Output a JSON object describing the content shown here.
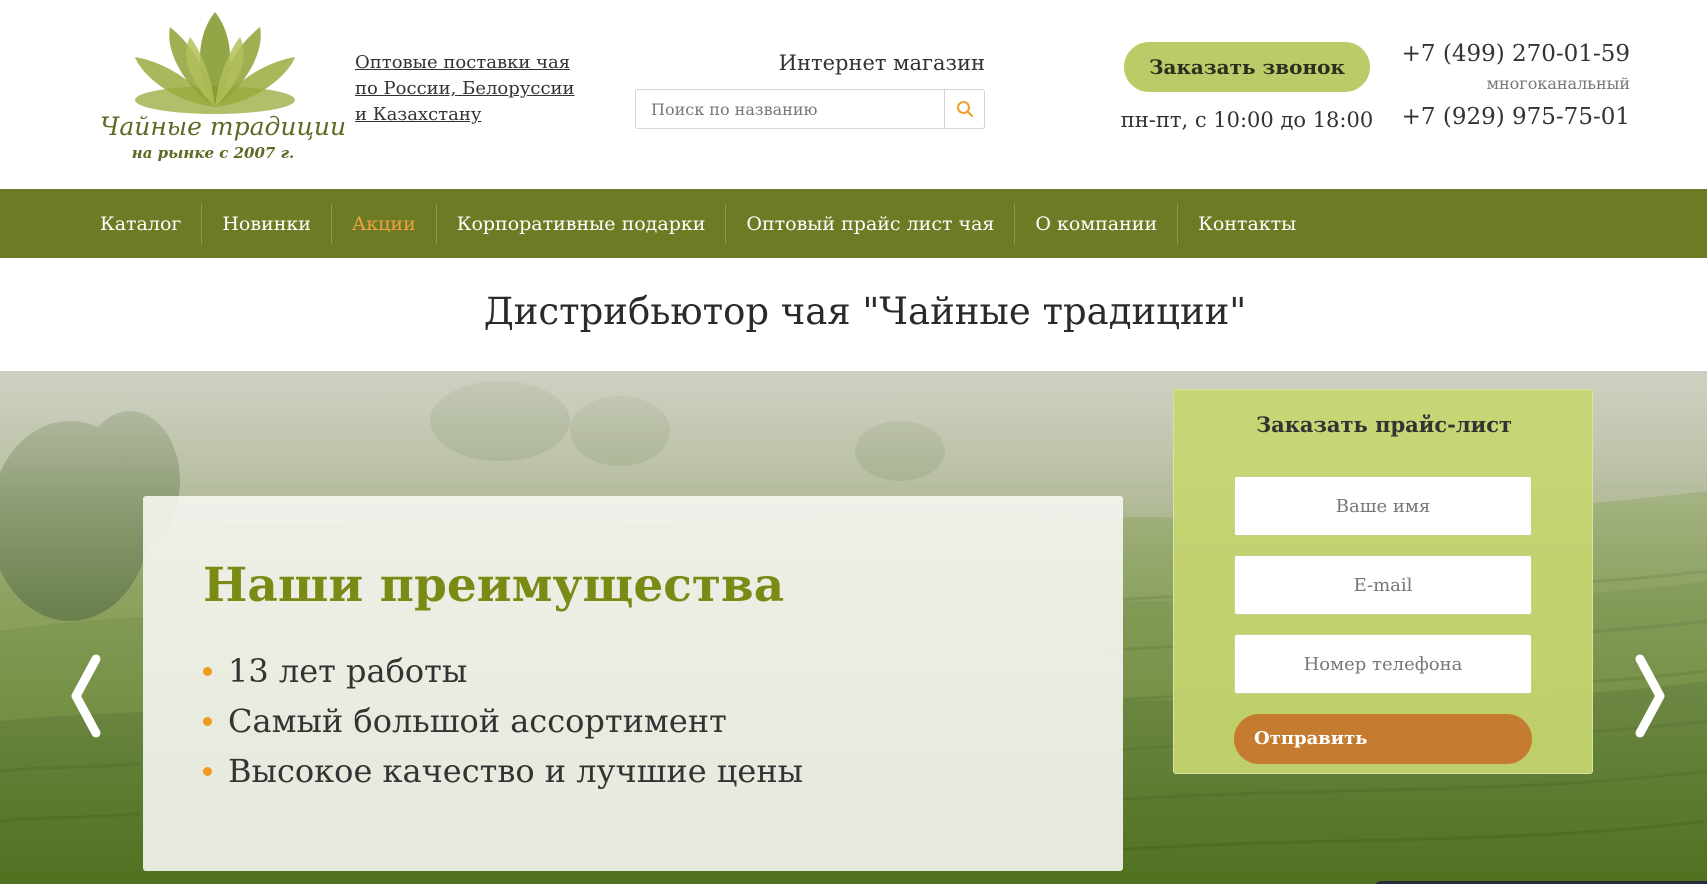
{
  "header": {
    "logo": {
      "title": "Чайные традиции",
      "subtitle": "на рынке с 2007 г."
    },
    "wholesale_link": "Оптовые поставки чая по России, Белоруссии и Казахстану",
    "shop_label": "Интернет магазин",
    "search": {
      "placeholder": "Поиск по названию",
      "icon": "search-icon"
    },
    "callback_label": "Заказать звонок",
    "hours": "пн-пт, с 10:00 до 18:00",
    "phone1": "+7 (499) 270-01-59",
    "phone1_note": "многоканальный",
    "phone2": "+7 (929) 975-75-01"
  },
  "nav": {
    "items": [
      {
        "label": "Каталог"
      },
      {
        "label": "Новинки"
      },
      {
        "label": "Акции",
        "active": true
      },
      {
        "label": "Корпоративные подарки"
      },
      {
        "label": "Оптовый прайс лист чая"
      },
      {
        "label": "О компании"
      },
      {
        "label": "Контакты"
      }
    ],
    "active_color": "#f0a040",
    "bg_color": "#6c7c25"
  },
  "page_title": "Дистрибьютор чая \"Чайные традиции\"",
  "hero": {
    "advantages": {
      "title": "Наши преимущества",
      "items": [
        "13 лет работы",
        "Самый большой ассортимент",
        "Высокое качество и лучшие цены"
      ],
      "title_color": "#7a8a14",
      "bullet_color": "#f29a1e"
    },
    "form": {
      "title": "Заказать прайс-лист",
      "name_placeholder": "Ваше имя",
      "email_placeholder": "E-mail",
      "phone_placeholder": "Номер телефона",
      "submit_label": "Отправить",
      "submit_color": "#c57c30"
    },
    "prev_icon": "chevron-left-icon",
    "next_icon": "chevron-right-icon"
  }
}
